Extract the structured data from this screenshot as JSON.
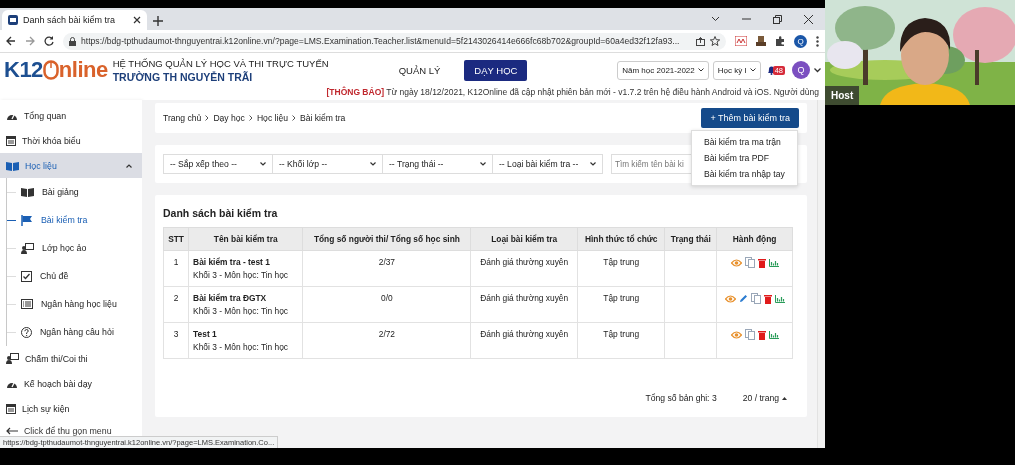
{
  "browser": {
    "tabs": [
      {
        "title": "Danh sách bài kiểm tra",
        "selected": true
      }
    ],
    "url": "https://bdg-tpthudaumot-thnguyentrai.k12online.vn/?page=LMS.Examination.Teacher.list&menuId=5f2143026414e666fc68b702&groupId=60a4ed32f12fa93...",
    "profile": "Q",
    "status_url": "https://bdg-tpthudaumot-thnguyentrai.k12online.vn/?page=LMS.Examination.Co..."
  },
  "header": {
    "logo": {
      "prefix": "K12",
      "suffix": "nline"
    },
    "system_title": "HỆ THỐNG QUẢN LÝ HỌC VÀ THI TRỰC TUYẾN",
    "school_name": "TRƯỜNG TH NGUYỄN TRÃI",
    "nav": [
      {
        "label": "QUẢN LÝ",
        "selected": false
      },
      {
        "label": "DẠY HỌC",
        "selected": true
      }
    ],
    "selects": [
      "Năm học 2021-2022",
      "Học kỳ I"
    ],
    "notification_count": "48",
    "avatar": "Q"
  },
  "notice": "**[THÔNG BÁO]** Từ ngày 18/12/2021, K12Online đã cập nhật phiên bản mới - v1.7.2 trên hệ điều hành Android và iOS. Người dùng",
  "sidebar": {
    "items": [
      {
        "label": "Tổng quan",
        "selected": false
      },
      {
        "label": "Thời khóa biểu",
        "selected": false
      },
      {
        "label": "Học liệu",
        "selected": true,
        "expanded": true,
        "children": [
          {
            "label": "Bài giảng",
            "selected": false
          },
          {
            "label": "Bài kiểm tra",
            "selected": true
          },
          {
            "label": "Lớp học ảo",
            "selected": false
          },
          {
            "label": "Chủ đề",
            "selected": false
          },
          {
            "label": "Ngân hàng học liệu",
            "selected": false
          },
          {
            "label": "Ngân hàng câu hỏi",
            "selected": false
          }
        ]
      },
      {
        "label": "Chấm thi/Coi thi",
        "selected": false
      },
      {
        "label": "Kế hoạch bài dạy",
        "selected": false
      },
      {
        "label": "Lịch sự kiện",
        "selected": false
      }
    ],
    "collapse_label": "Click để thu gọn menu"
  },
  "breadcrumb": [
    "Trang chủ",
    "Dạy học",
    "Học liệu",
    "Bài kiểm tra"
  ],
  "add_button": "+ Thêm bài kiểm tra",
  "add_menu": [
    "Bài kiểm tra ma trận",
    "Bài kiểm tra PDF",
    "Bài kiểm tra nhập tay"
  ],
  "filters": [
    "-- Sắp xếp theo --",
    "-- Khối lớp --",
    "-- Trạng thái --",
    "-- Loại bài kiểm tra --"
  ],
  "search": {
    "placeholder": "Tìm kiếm tên bài ki"
  },
  "table": {
    "title": "Danh sách bài kiểm tra",
    "columns": [
      "STT",
      "Tên bài kiểm tra",
      "Tổng số người thi/ Tổng số học sinh",
      "Loại bài kiểm tra",
      "Hình thức tổ chức",
      "Trạng thái",
      "Hành động"
    ],
    "rows": [
      {
        "stt": "1",
        "name": "Bài kiểm tra - test 1",
        "subtitle": "Khối 3 - Môn học: Tin học",
        "count": "2/37",
        "type": "Đánh giá thường xuyên",
        "form": "Tập trung",
        "editable": false
      },
      {
        "stt": "2",
        "name": "Bài kiểm tra ĐGTX",
        "subtitle": "Khối 3 - Môn học: Tin học",
        "count": "0/0",
        "type": "Đánh giá thường xuyên",
        "form": "Tập trung",
        "editable": true
      },
      {
        "stt": "3",
        "name": "Test 1",
        "subtitle": "Khối 3 - Môn học: Tin học",
        "count": "2/72",
        "type": "Đánh giá thường xuyên",
        "form": "Tập trung",
        "editable": false
      }
    ]
  },
  "pagination": {
    "total": "Tổng số bản ghi: 3",
    "page_size": "20 / trang"
  },
  "video": {
    "label": "Host"
  }
}
